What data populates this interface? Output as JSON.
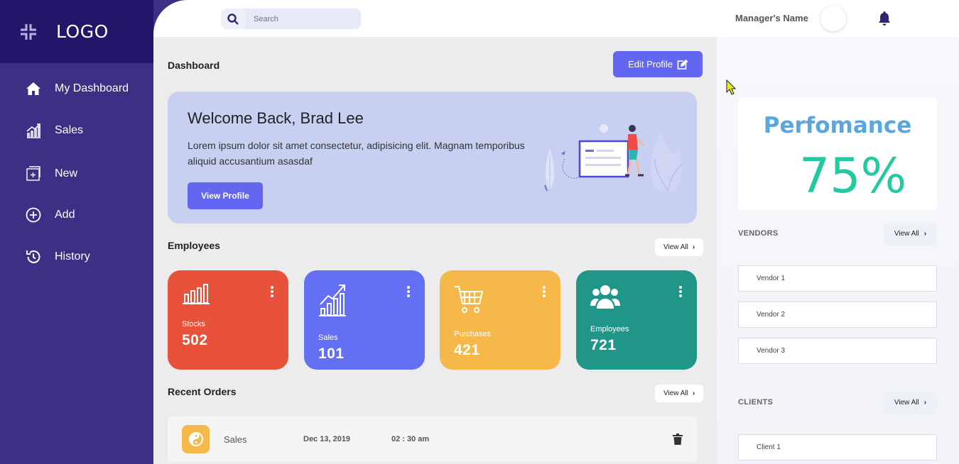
{
  "brand": {
    "logo_text": "LOGO"
  },
  "sidebar": {
    "items": [
      {
        "label": "My Dashboard",
        "icon": "home-icon"
      },
      {
        "label": "Sales",
        "icon": "growth-chart-icon"
      },
      {
        "label": "New",
        "icon": "new-window-icon"
      },
      {
        "label": "Add",
        "icon": "plus-circle-icon"
      },
      {
        "label": "History",
        "icon": "history-icon"
      }
    ]
  },
  "header": {
    "search_placeholder": "Search",
    "manager_name": "Manager's Name"
  },
  "main": {
    "title": "Dashboard",
    "edit_profile_label": "Edit Profile",
    "welcome": {
      "heading": "Welcome Back, Brad Lee",
      "text": "Lorem ipsum dolor sit amet consectetur, adipisicing elit. Magnam temporibus aliquid accusantium asasdaf",
      "button_label": "View Profile"
    },
    "employees_title": "Employees",
    "view_all_label": "View All",
    "cards": [
      {
        "label": "Stocks",
        "value": "502",
        "color": "#e8523b",
        "icon": "bar-chart-icon"
      },
      {
        "label": "Sales",
        "value": "101",
        "color": "#6470f4",
        "icon": "growth-chart-icon"
      },
      {
        "label": "Purchases",
        "value": "421",
        "color": "#f5b849",
        "icon": "shopping-cart-icon"
      },
      {
        "label": "Employees",
        "value": "721",
        "color": "#1f9688",
        "icon": "users-icon"
      }
    ],
    "recent_orders_title": "Recent Orders",
    "orders": [
      {
        "name": "Sales",
        "date": "Dec 13, 2019",
        "time": "02 : 30 am"
      }
    ]
  },
  "right_panel": {
    "performance_title": "Perfomance",
    "performance_value": "75%",
    "vendors_label": "VENDORS",
    "vendors": [
      "Vendor 1",
      "Vendor 2",
      "Vendor 3"
    ],
    "clients_label": "CLIENTS",
    "clients": [
      "Client 1"
    ],
    "view_all_label": "View All"
  }
}
